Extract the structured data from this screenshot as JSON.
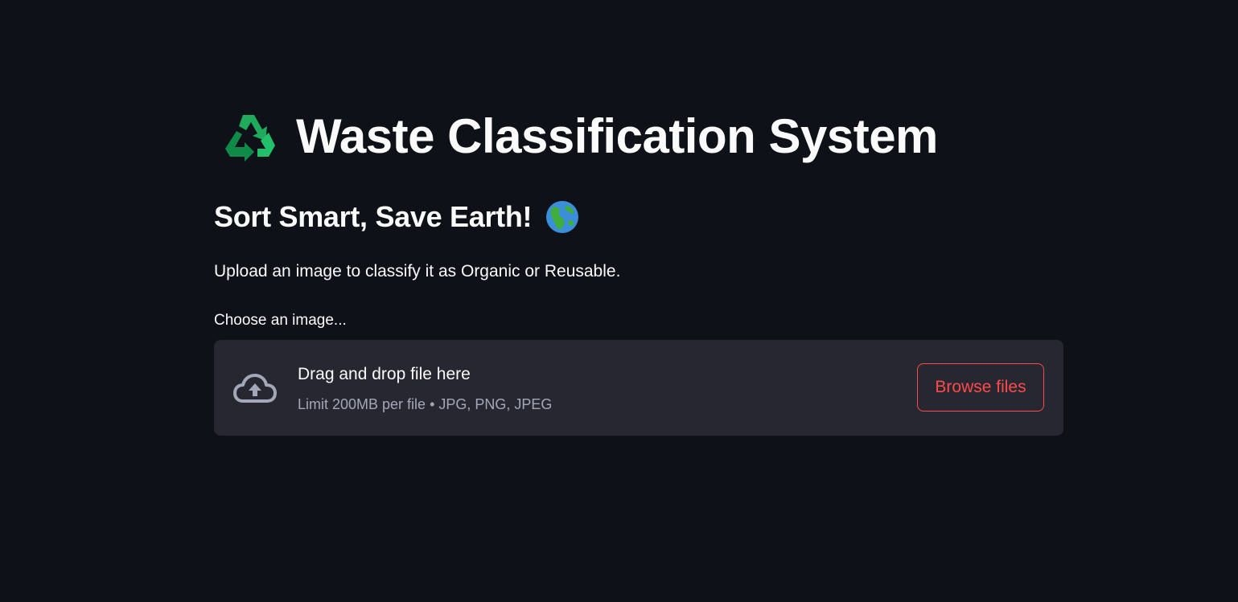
{
  "header": {
    "title": "Waste Classification System",
    "title_icon": "recycle-icon",
    "subtitle": "Sort Smart, Save Earth!",
    "subtitle_icon": "globe-icon"
  },
  "description": "Upload an image to classify it as Organic or Reusable.",
  "uploader": {
    "label": "Choose an image...",
    "icon": "cloud-upload-icon",
    "instruction": "Drag and drop file here",
    "limit_text": "Limit 200MB per file • JPG, PNG, JPEG",
    "browse_label": "Browse files"
  },
  "colors": {
    "background": "#0e1117",
    "dropzone": "#262730",
    "accent": "#ff4b4b",
    "recycle_green": "#1faa5c"
  }
}
